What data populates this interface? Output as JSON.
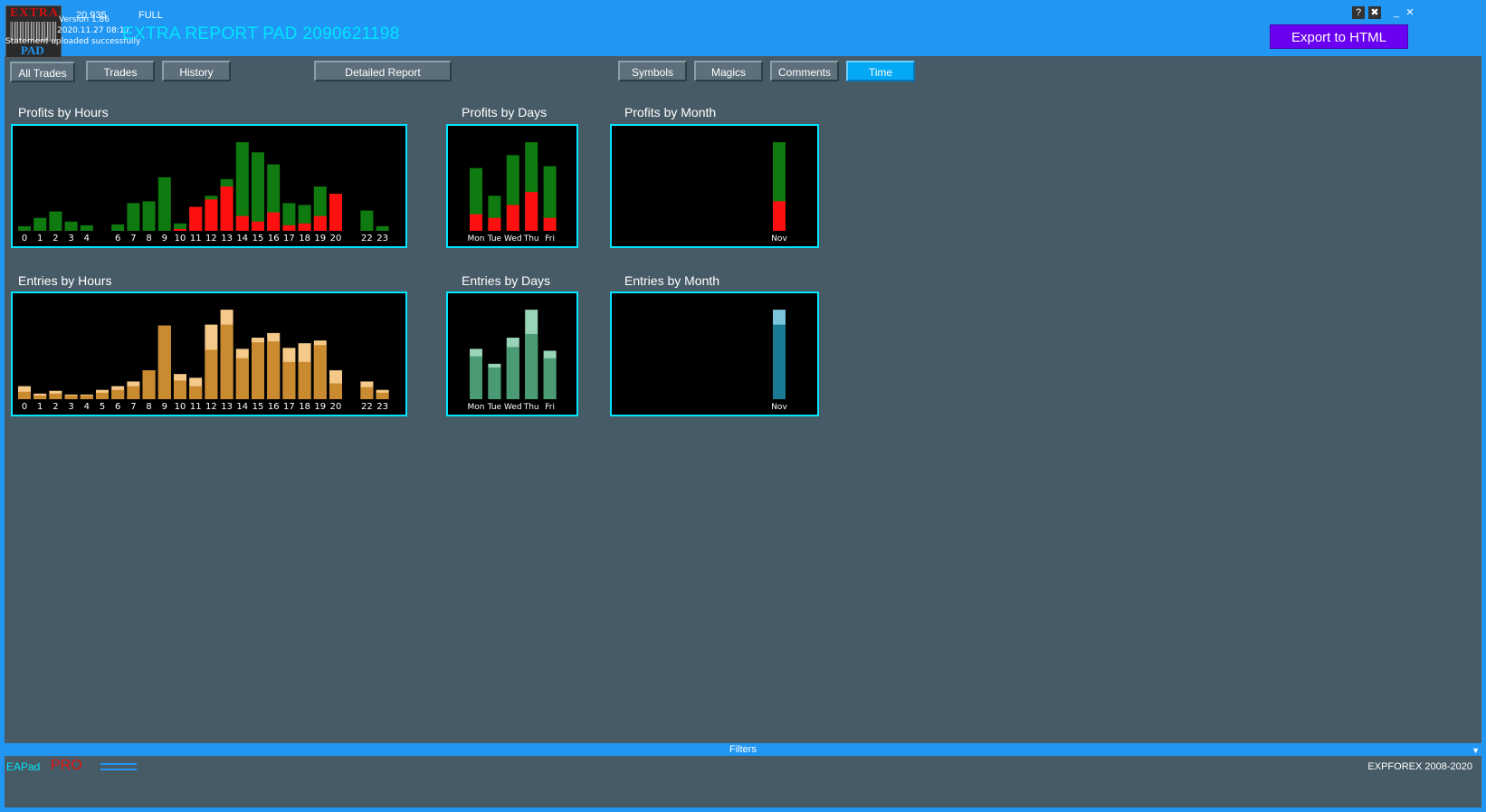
{
  "header": {
    "logo_text_top": "EXTRA",
    "logo_text_bottom": "PAD",
    "value": "20.935",
    "mode": "FULL",
    "version_line": "Version 1.86",
    "date_line": "2020.11.27 08:17",
    "status_line": "Statement uploaded successfully",
    "title": "EXTRA REPORT PAD 2090621198",
    "export_label": "Export to HTML",
    "help_glyph": "?",
    "settings_glyph": "✖",
    "minimize_glyph": "_",
    "close_glyph": "✕"
  },
  "tabs": {
    "all_trades": "All Trades",
    "trades": "Trades",
    "history": "History",
    "detailed_report": "Detailed Report",
    "symbols": "Symbols",
    "magics": "Magics",
    "comments": "Comments",
    "time": "Time",
    "active": "Time"
  },
  "colors": {
    "profit": "#0f7a0f",
    "loss": "#ff1010",
    "entries_main": "#c98a30",
    "entries_top": "#f4c98a",
    "days_main": "#4a9a74",
    "days_top": "#9ad4b8",
    "month_main": "#1a7a94",
    "month_top": "#7ac4dc",
    "accent": "#00e5ff"
  },
  "chart_data": [
    {
      "id": "profits_hours",
      "type": "bar",
      "title": "Profits by Hours",
      "categories": [
        "0",
        "1",
        "2",
        "3",
        "4",
        "",
        "6",
        "7",
        "8",
        "9",
        "10",
        "11",
        "12",
        "13",
        "14",
        "15",
        "16",
        "17",
        "18",
        "19",
        "20",
        "",
        "22",
        "23"
      ],
      "series": [
        {
          "values": [
            5,
            14,
            21,
            10,
            6,
            0,
            7,
            30,
            32,
            58,
            8,
            26,
            38,
            56,
            96,
            85,
            72,
            30,
            28,
            48,
            40,
            0,
            22,
            5
          ]
        },
        {
          "values": [
            0,
            0,
            0,
            0,
            0,
            0,
            0,
            0,
            0,
            0,
            2,
            26,
            34,
            48,
            16,
            10,
            20,
            6,
            8,
            16,
            40,
            0,
            0,
            0
          ]
        }
      ],
      "ylim": [
        0,
        100
      ]
    },
    {
      "id": "profits_days",
      "type": "bar",
      "title": "Profits by Days",
      "categories": [
        "Mon",
        "Tue",
        "Wed",
        "Thu",
        "Fri"
      ],
      "series": [
        {
          "values": [
            68,
            38,
            82,
            96,
            70
          ]
        },
        {
          "values": [
            18,
            14,
            28,
            42,
            14
          ]
        }
      ],
      "ylim": [
        0,
        100
      ]
    },
    {
      "id": "profits_month",
      "type": "bar",
      "title": "Profits by Month",
      "categories": [
        "Nov"
      ],
      "series": [
        {
          "values": [
            96
          ]
        },
        {
          "values": [
            32
          ]
        }
      ],
      "ylim": [
        0,
        100
      ]
    },
    {
      "id": "entries_hours",
      "type": "bar",
      "title": "Entries by Hours",
      "categories": [
        "0",
        "1",
        "2",
        "3",
        "4",
        "5",
        "6",
        "7",
        "8",
        "9",
        "10",
        "11",
        "12",
        "13",
        "14",
        "15",
        "16",
        "17",
        "18",
        "19",
        "20",
        "",
        "22",
        "23"
      ],
      "series": [
        {
          "values": [
            14,
            6,
            9,
            5,
            5,
            10,
            14,
            19,
            31,
            79,
            27,
            23,
            80,
            96,
            54,
            66,
            71,
            55,
            60,
            63,
            31,
            0,
            19,
            10
          ]
        },
        {
          "values": [
            8,
            4,
            6,
            4,
            4,
            7,
            10,
            14,
            31,
            79,
            20,
            14,
            53,
            80,
            44,
            61,
            62,
            40,
            40,
            58,
            17,
            0,
            13,
            7
          ]
        }
      ],
      "ylim": [
        0,
        100
      ]
    },
    {
      "id": "entries_days",
      "type": "bar",
      "title": "Entries by Days",
      "categories": [
        "Mon",
        "Tue",
        "Wed",
        "Thu",
        "Fri"
      ],
      "series": [
        {
          "values": [
            54,
            38,
            66,
            96,
            52
          ]
        },
        {
          "values": [
            46,
            34,
            56,
            70,
            44
          ]
        }
      ],
      "ylim": [
        0,
        100
      ]
    },
    {
      "id": "entries_month",
      "type": "bar",
      "title": "Entries by Month",
      "categories": [
        "Nov"
      ],
      "series": [
        {
          "values": [
            96
          ]
        },
        {
          "values": [
            80
          ]
        }
      ],
      "ylim": [
        0,
        100
      ]
    }
  ],
  "filters_label": "Filters",
  "footer": {
    "ea": "EAPad",
    "pro": "PRO",
    "copyright": "EXPFOREX 2008-2020"
  }
}
